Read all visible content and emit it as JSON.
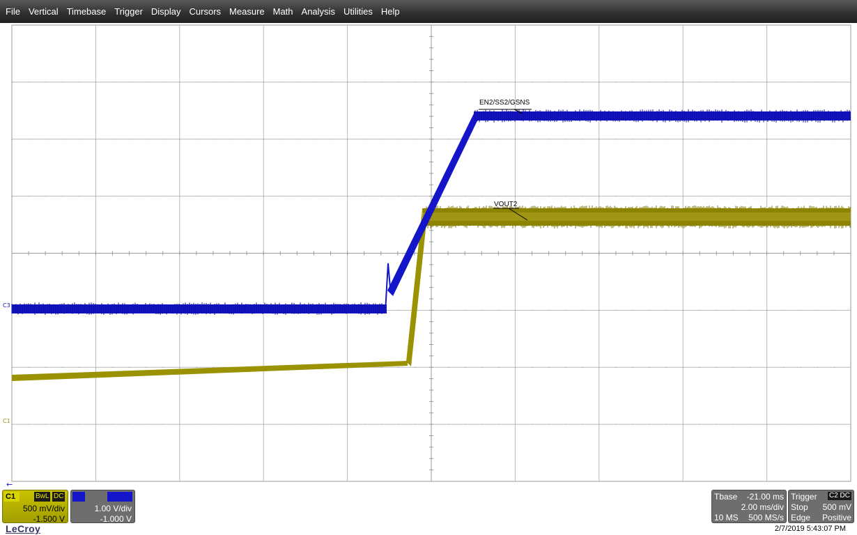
{
  "menu": [
    "File",
    "Vertical",
    "Timebase",
    "Trigger",
    "Display",
    "Cursors",
    "Measure",
    "Math",
    "Analysis",
    "Utilities",
    "Help"
  ],
  "traces": {
    "ch3_label": "EN2/SS2/GSNS",
    "ch1_label": "VOUT2",
    "ch3_color": "#1414c8",
    "ch1_color": "#9a9200"
  },
  "markers": {
    "c3": "C3",
    "c1": "C1"
  },
  "channel1": {
    "tag": "C1",
    "bwl": "BwL",
    "coupling": "DC",
    "scale": "500 mV/div",
    "offset": "-1.500 V"
  },
  "channel3": {
    "scale": "1.00 V/div",
    "offset": "-1.000 V"
  },
  "timebase": {
    "title": "Tbase",
    "delay": "-21.00 ms",
    "scale": "2.00 ms/div",
    "samples": "10 MS",
    "rate": "500 MS/s"
  },
  "trigger": {
    "title": "Trigger",
    "tag": "C2 DC",
    "mode": "Stop",
    "level": "500 mV",
    "type": "Edge",
    "slope": "Positive"
  },
  "brand": "LeCroy",
  "timestamp": "2/7/2019 5:43:07 PM"
}
